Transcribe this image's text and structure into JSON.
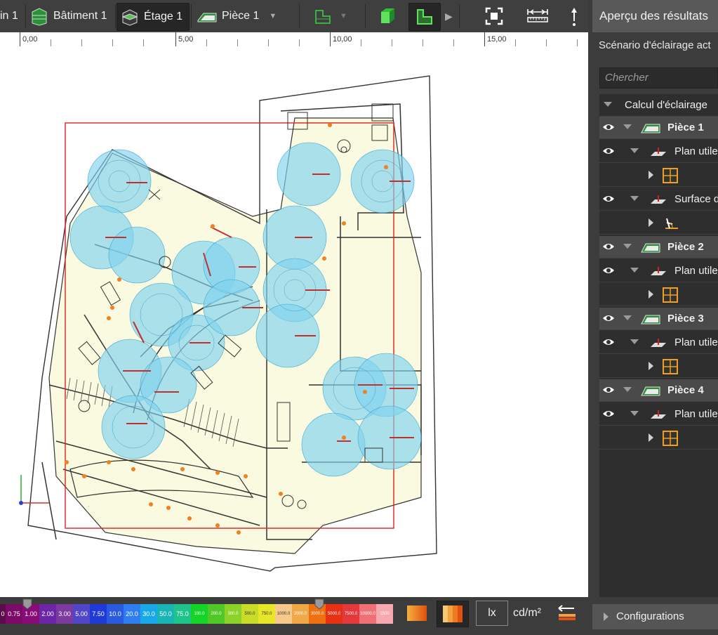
{
  "toolbar": {
    "site_label": "in 1",
    "building_label": "Bâtiment 1",
    "floor_label": "Étage 1",
    "room_label": "Pièce 1"
  },
  "ruler": {
    "labels": [
      "0,00",
      "5,00",
      "10,00",
      "15,00"
    ]
  },
  "panel": {
    "title": "Aperçu des résultats",
    "scenario": "Scénario d'éclairage act",
    "search_placeholder": "Chercher",
    "tree": [
      {
        "label": "Calcul d'éclairage",
        "level": 0
      },
      {
        "label": "Pièce 1",
        "level": 1
      },
      {
        "label": "Plan utile",
        "level": 2
      },
      {
        "label": "Surface d",
        "level": 2
      },
      {
        "label": "Pièce 2",
        "level": 1
      },
      {
        "label": "Plan utile",
        "level": 2
      },
      {
        "label": "Pièce 3",
        "level": 1
      },
      {
        "label": "Plan utile",
        "level": 2
      },
      {
        "label": "Pièce 4",
        "level": 1
      },
      {
        "label": "Plan utile",
        "level": 2
      }
    ],
    "config_label": "Configurations"
  },
  "legend": {
    "values": [
      "0",
      "0.75",
      "1.00",
      "2.00",
      "3.00",
      "5.00",
      "7.50",
      "10.0",
      "20.0",
      "30.0",
      "50.0",
      "75.0",
      "100.0",
      "200.0",
      "300.0",
      "500.0",
      "750.0",
      "1000.0",
      "2000.0",
      "3000.0",
      "5000.0",
      "7500.0",
      "10000.0",
      "1500"
    ],
    "colors": [
      "#5a0b4a",
      "#7a0a66",
      "#8a0a78",
      "#6b26a8",
      "#7a3aa0",
      "#5246c8",
      "#1f3ad8",
      "#2a5ae0",
      "#2f7ef0",
      "#18a8e8",
      "#19b5b5",
      "#1ec48c",
      "#14d428",
      "#50c828",
      "#8cd228",
      "#c8dc28",
      "#e8e628",
      "#f6c88a",
      "#f0a848",
      "#f07010",
      "#e83014",
      "#e4383c",
      "#f07078",
      "#f8a8b0"
    ],
    "unit_lux": "lx",
    "unit_cd": "cd/m²"
  },
  "colors": {
    "accent_green": "#3cb043",
    "floor_fill": "#fafae0",
    "lamp_blue": "#7fd3ee",
    "selection_red": "#e02020",
    "orange": "#f0a020"
  }
}
